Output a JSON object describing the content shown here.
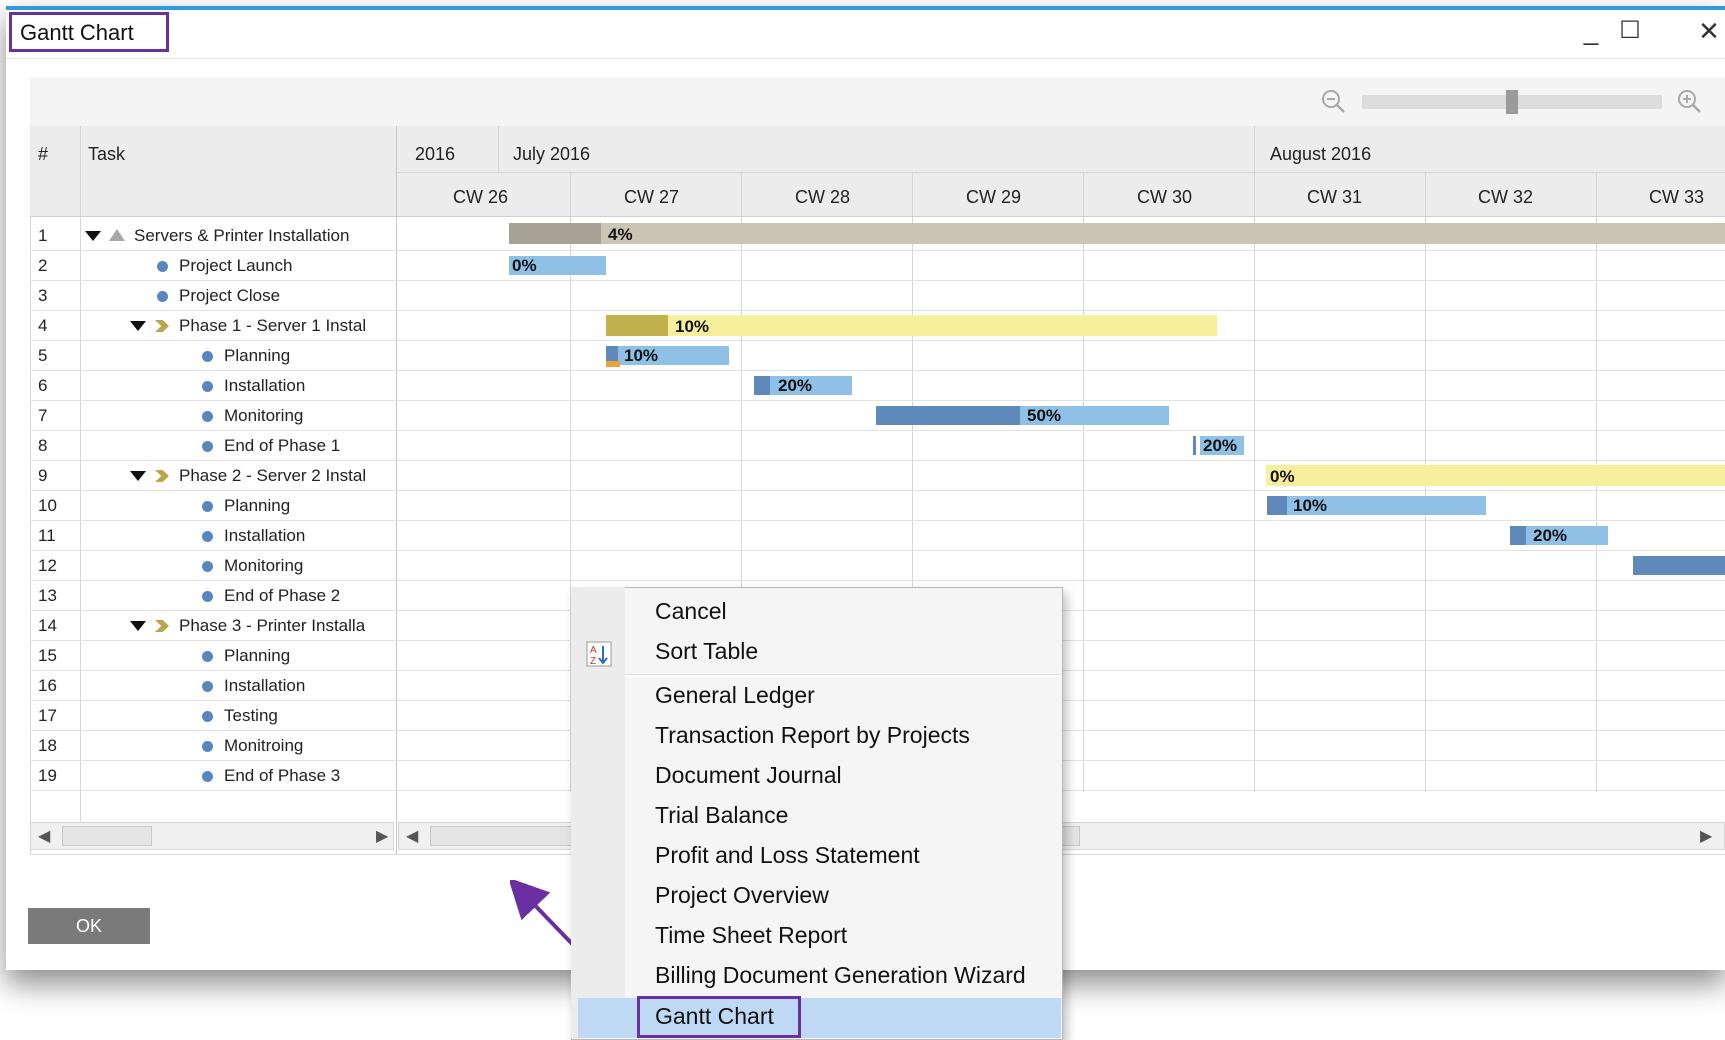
{
  "window": {
    "title": "Gantt Chart",
    "minimize": "_",
    "maximize": "☐",
    "close": "✕"
  },
  "grid": {
    "col_num": "#",
    "col_task": "Task",
    "years": [
      "2016",
      "July 2016",
      "August 2016"
    ],
    "weeks": [
      "CW 26",
      "CW 27",
      "CW 28",
      "CW 29",
      "CW 30",
      "CW 31",
      "CW 32",
      "CW 33"
    ],
    "rows": [
      {
        "n": "1",
        "task": "Servers & Printer Installation",
        "kind": "summary"
      },
      {
        "n": "2",
        "task": "Project Launch",
        "kind": "task"
      },
      {
        "n": "3",
        "task": "Project Close",
        "kind": "task"
      },
      {
        "n": "4",
        "task": "Phase 1 - Server 1 Instal",
        "kind": "phase"
      },
      {
        "n": "5",
        "task": "Planning",
        "kind": "sub"
      },
      {
        "n": "6",
        "task": "Installation",
        "kind": "sub"
      },
      {
        "n": "7",
        "task": "Monitoring",
        "kind": "sub"
      },
      {
        "n": "8",
        "task": "End of Phase 1",
        "kind": "sub"
      },
      {
        "n": "9",
        "task": "Phase 2 - Server 2 Instal",
        "kind": "phase"
      },
      {
        "n": "10",
        "task": "Planning",
        "kind": "sub"
      },
      {
        "n": "11",
        "task": "Installation",
        "kind": "sub"
      },
      {
        "n": "12",
        "task": "Monitoring",
        "kind": "sub"
      },
      {
        "n": "13",
        "task": "End of Phase 2",
        "kind": "sub"
      },
      {
        "n": "14",
        "task": "Phase 3 - Printer Installa",
        "kind": "phase"
      },
      {
        "n": "15",
        "task": "Planning",
        "kind": "sub"
      },
      {
        "n": "16",
        "task": "Installation",
        "kind": "sub"
      },
      {
        "n": "17",
        "task": "Testing",
        "kind": "sub"
      },
      {
        "n": "18",
        "task": "Monitroing",
        "kind": "sub"
      },
      {
        "n": "19",
        "task": "End of Phase 3",
        "kind": "sub"
      }
    ],
    "bar_labels": [
      "4%",
      "0%",
      "10%",
      "10%",
      "20%",
      "50%",
      "20%",
      "0%",
      "10%",
      "20%"
    ]
  },
  "colors": {
    "summary_bar": "#c9c6b6",
    "summary_done": "#a6a396",
    "phase_bar": "#f7ef9c",
    "phase_done": "#c2b24e",
    "task_bar": "#8fc1e6",
    "task_done": "#5f88bb",
    "menu_highlight": "#bfd9f5",
    "callout": "#6a2fa0"
  },
  "buttons": {
    "ok": "OK"
  },
  "context_menu": {
    "items": [
      "Cancel",
      "Sort Table",
      "General Ledger",
      "Transaction Report by Projects",
      "Document Journal",
      "Trial Balance",
      "Profit and Loss Statement",
      "Project Overview",
      "Time Sheet Report",
      "Billing Document Generation Wizard",
      "Gantt Chart"
    ],
    "highlighted": "Gantt Chart"
  },
  "icons": {
    "zoom_out": "zoom-out-icon",
    "zoom_in": "zoom-in-icon",
    "sort": "sort-table-icon"
  }
}
